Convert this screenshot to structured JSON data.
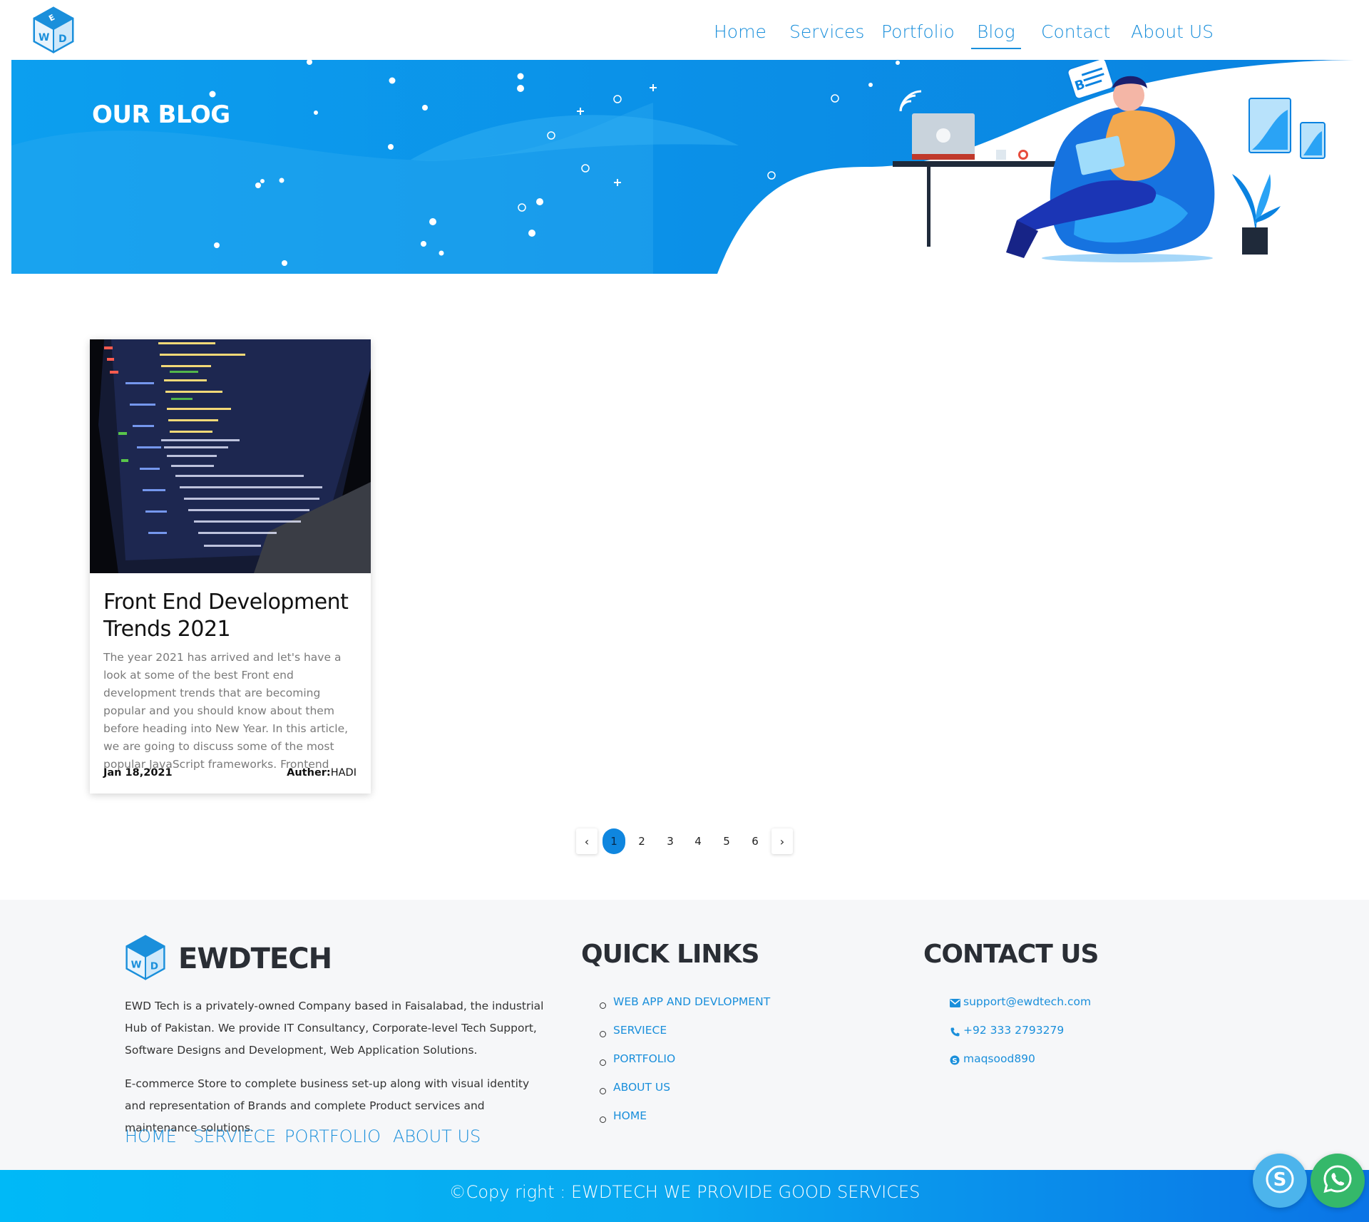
{
  "header": {
    "logo_alt": "EWD",
    "nav": [
      {
        "label": "Home"
      },
      {
        "label": "Services"
      },
      {
        "label": "Portfolio"
      },
      {
        "label": "Blog"
      },
      {
        "label": "Contact"
      },
      {
        "label": "About US"
      }
    ],
    "active_nav": "Blog"
  },
  "hero": {
    "title": "OUR BLOG"
  },
  "posts": [
    {
      "title": "Front End Development Trends 2021",
      "excerpt": "The year 2021 has arrived and let's have a look at some of the best Front end development trends that are becoming popular and you should know about them before heading into New Year. In this article, we are going to discuss some of the most popular JavaScript frameworks. Frontend",
      "date": "Jan 18,2021",
      "author_label": "Auther:",
      "author": "HADI",
      "image_icon": "code-screen-photo"
    }
  ],
  "pagination": {
    "prev": "‹",
    "next": "›",
    "pages": [
      "1",
      "2",
      "3",
      "4",
      "5",
      "6"
    ],
    "current": "1"
  },
  "footer": {
    "brand": "EWDTECH",
    "about": [
      "EWD Tech is a privately-owned Company based in Faisalabad, the industrial Hub of Pakistan. We provide IT Consultancy, Corporate-level Tech Support, Software Designs and Development, Web Application Solutions.",
      "E-commerce Store to complete business set-up along with visual identity and representation of Brands and complete Product services and maintenance solutions."
    ],
    "links": [
      "HOME",
      "SERVIECE",
      "PORTFOLIO",
      "ABOUT US"
    ],
    "quick_links_title": "QUICK LINKS",
    "quick_links": [
      "WEB APP AND DEVLOPMENT",
      "SERVIECE",
      "PORTFOLIO",
      "ABOUT US",
      "HOME"
    ],
    "contact_title": "CONTACT US",
    "contact": {
      "email": "support@ewdtech.com",
      "phone": "+92 333 2793279",
      "skype": "maqsood890"
    }
  },
  "copyright": "©Copy right : EWDTECH WE PROVIDE GOOD SERVICES",
  "colors": {
    "accent": "#1a8fdb",
    "hero_blue": "#0a8fe6",
    "footer_bg": "#f6f7f9",
    "skype": "#4cb4ec",
    "whatsapp": "#35b86a"
  },
  "floating_buttons": [
    "skype-icon",
    "whatsapp-icon"
  ]
}
